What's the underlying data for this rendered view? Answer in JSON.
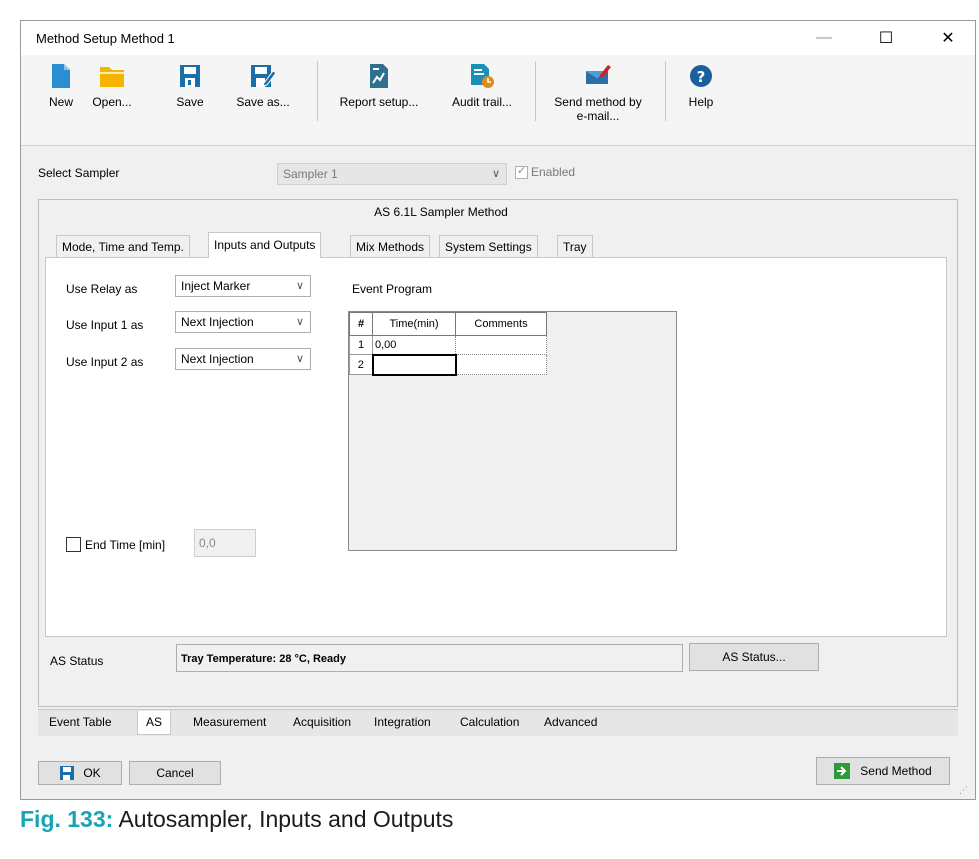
{
  "window": {
    "title": "Method Setup Method 1",
    "controls": {
      "minimize": "—",
      "maximize": "☐",
      "close": "✕"
    }
  },
  "toolbar": {
    "items": [
      {
        "label": "New",
        "icon": "new-document-icon"
      },
      {
        "label": "Open...",
        "icon": "folder-icon"
      },
      {
        "label": "Save",
        "icon": "save-icon"
      },
      {
        "label": "Save as...",
        "icon": "save-as-icon"
      },
      {
        "label": "Report setup...",
        "icon": "report-setup-icon"
      },
      {
        "label": "Audit trail...",
        "icon": "audit-trail-icon"
      },
      {
        "label": "Send method by",
        "label2": "e-mail...",
        "icon": "send-email-icon"
      },
      {
        "label": "Help",
        "icon": "help-icon"
      }
    ]
  },
  "sampler": {
    "label": "Select Sampler",
    "value": "Sampler 1",
    "enabled_label": "Enabled",
    "enabled_checked": true
  },
  "method": {
    "title": "AS 6.1L Sampler Method",
    "tabs": [
      "Mode, Time and Temp.",
      "Inputs and Outputs",
      "Mix Methods",
      "System Settings",
      "Tray"
    ],
    "active_tab": "Inputs and Outputs"
  },
  "io": {
    "relay_label": "Use Relay as",
    "relay_value": "Inject Marker",
    "input1_label": "Use Input 1 as",
    "input1_value": "Next Injection",
    "input2_label": "Use Input 2 as",
    "input2_value": "Next Injection",
    "end_time_label": "End Time [min]",
    "end_time_value": "0,0",
    "end_time_checked": false
  },
  "event_program": {
    "title": "Event Program",
    "columns": [
      "#",
      "Time(min)",
      "Comments"
    ],
    "rows": [
      {
        "num": "1",
        "time": "0,00",
        "comment": ""
      },
      {
        "num": "2",
        "time": "",
        "comment": ""
      }
    ]
  },
  "status": {
    "label": "AS Status",
    "text": "Tray Temperature: 28 °C, Ready",
    "button": "AS Status..."
  },
  "bottom_tabs": {
    "items": [
      "Event Table",
      "AS",
      "Measurement",
      "Acquisition",
      "Integration",
      "Calculation",
      "Advanced"
    ],
    "active": "AS"
  },
  "footer": {
    "ok": "OK",
    "cancel": "Cancel",
    "send": "Send Method"
  },
  "caption": {
    "fig": "Fig. 133:",
    "text": "Autosampler, Inputs and Outputs"
  },
  "colors": {
    "accent_blue": "#1a6fa8",
    "folder_yellow": "#f5b400",
    "caption_teal": "#1aa3b5"
  }
}
